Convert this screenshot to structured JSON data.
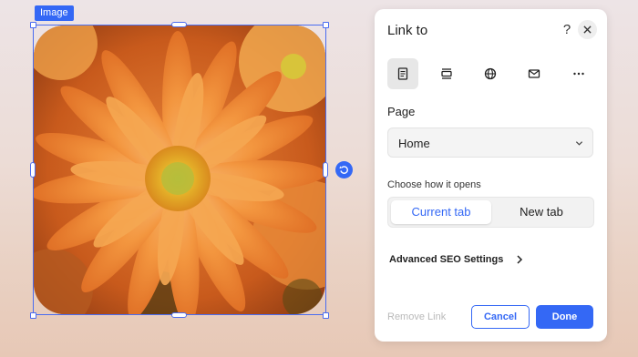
{
  "canvas": {
    "element_tag": "Image",
    "image_subject": "orange-daisy-flower-image"
  },
  "panel": {
    "title": "Link to",
    "help_glyph": "?",
    "link_types": [
      {
        "icon": "page-icon",
        "active": true
      },
      {
        "icon": "anchor-icon",
        "active": false
      },
      {
        "icon": "globe-icon",
        "active": false
      },
      {
        "icon": "email-icon",
        "active": false
      },
      {
        "icon": "more-icon",
        "active": false
      }
    ],
    "page_label": "Page",
    "page_select_value": "Home",
    "opens_label": "Choose how it opens",
    "open_options": [
      "Current tab",
      "New tab"
    ],
    "selected_open_option": "Current tab",
    "seo_label": "Advanced SEO Settings",
    "remove_link_label": "Remove Link",
    "cancel_label": "Cancel",
    "done_label": "Done"
  },
  "colors": {
    "accent": "#3468f5",
    "disabled_text": "#b9b9b9"
  }
}
